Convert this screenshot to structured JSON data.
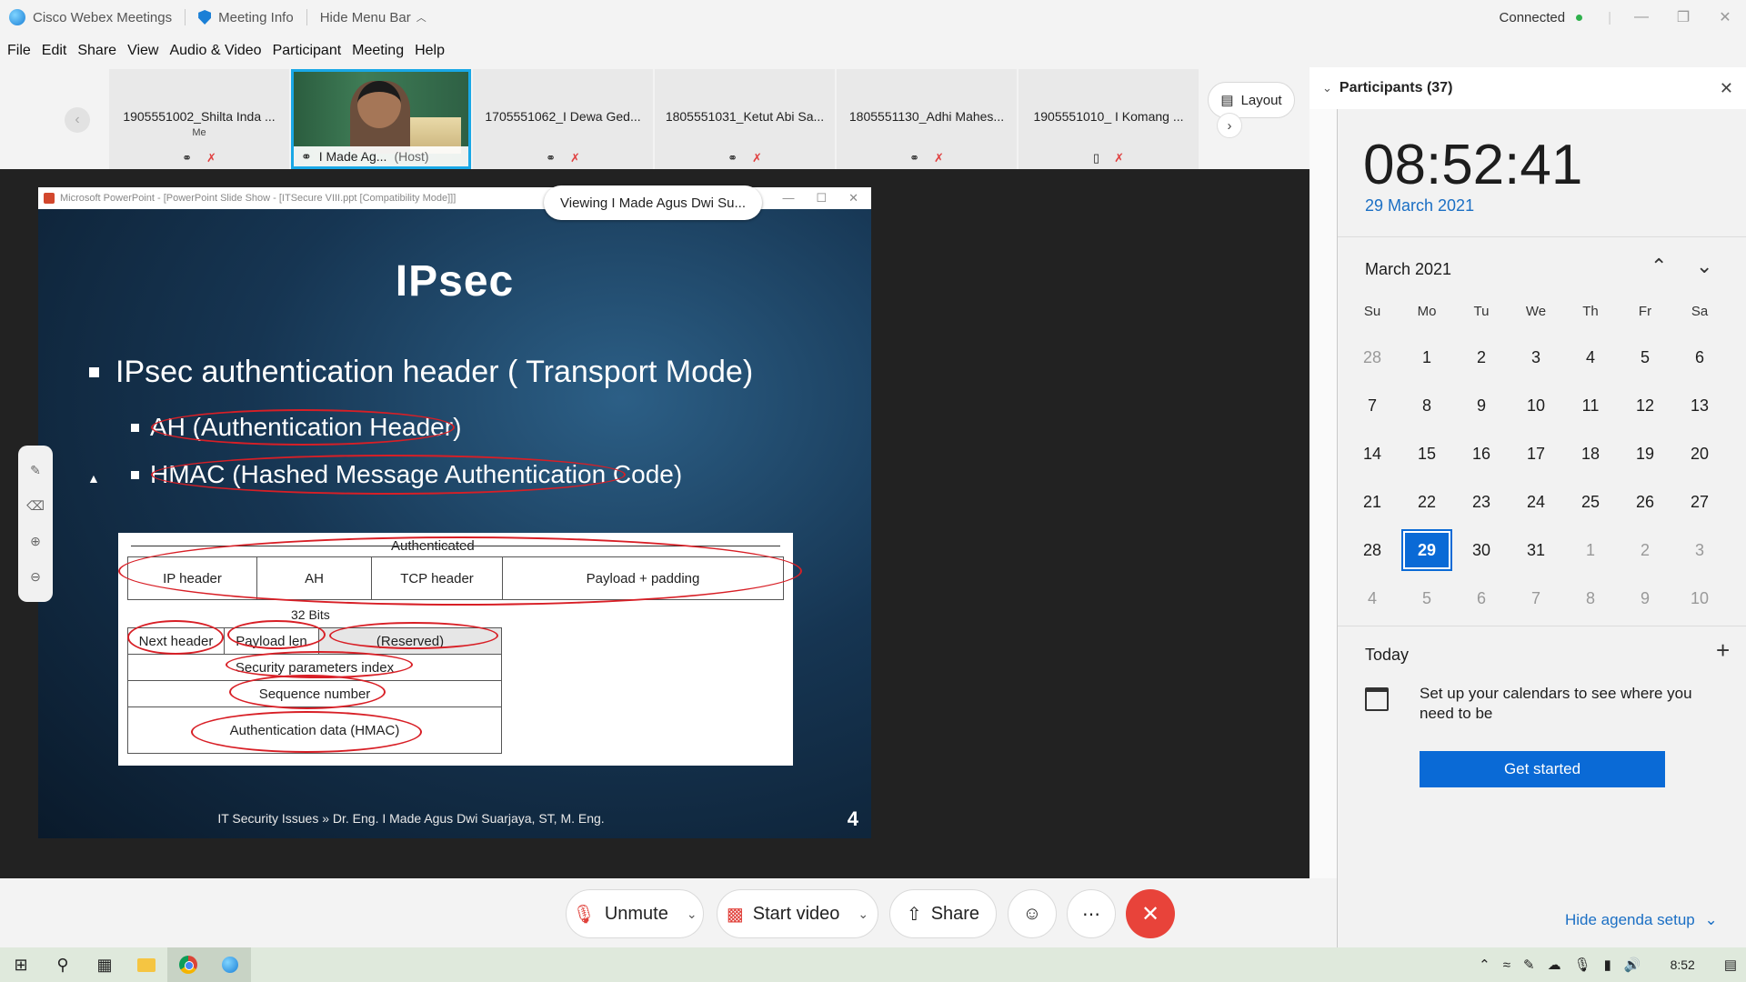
{
  "titlebar": {
    "app_name": "Cisco Webex Meetings",
    "meeting_info": "Meeting Info",
    "hide_menu_bar": "Hide Menu Bar",
    "status": "Connected"
  },
  "menu": [
    "File",
    "Edit",
    "Share",
    "View",
    "Audio & Video",
    "Participant",
    "Meeting",
    "Help"
  ],
  "thumbnails": [
    {
      "name": "1905551002_Shilta Inda ...",
      "sub": "Me"
    },
    {
      "name": "I Made Ag...",
      "sub": "(Host)"
    },
    {
      "name": "1705551062_I Dewa Ged..."
    },
    {
      "name": "1805551031_Ketut Abi Sa..."
    },
    {
      "name": "1805551130_Adhi Mahes..."
    },
    {
      "name": "1905551010_ I Komang ..."
    }
  ],
  "layout_button": "Layout",
  "slide": {
    "window_title": "Microsoft PowerPoint - [PowerPoint Slide Show - [ITSecure VIII.ppt [Compatibility Mode]]]",
    "viewing": "Viewing I Made Agus Dwi Su...",
    "heading": "IPsec",
    "bullet_main": "IPsec authentication header ( Transport Mode)",
    "bullet_sub1": "AH (Authentication Header)",
    "bullet_sub2": "HMAC (Hashed Message Authentication Code)",
    "diagram": {
      "authenticated": "Authenticated",
      "row1": [
        "IP header",
        "AH",
        "TCP header",
        "Payload + padding"
      ],
      "bits": "32 Bits",
      "next_header": "Next header",
      "payload_len": "Payload len",
      "reserved": "(Reserved)",
      "spi": "Security parameters index",
      "seq": "Sequence number",
      "auth_data": "Authentication data (HMAC)"
    },
    "footer": "IT Security Issues » Dr. Eng. I Made Agus Dwi Suarjaya, ST, M. Eng.",
    "page_number": "4"
  },
  "controls": {
    "unmute": "Unmute",
    "start_video": "Start video",
    "share": "Share"
  },
  "participants": {
    "title": "Participants (37)"
  },
  "calendar": {
    "time": "08:52:41",
    "date": "29 March 2021",
    "month": "March 2021",
    "dow": [
      "Su",
      "Mo",
      "Tu",
      "We",
      "Th",
      "Fr",
      "Sa"
    ],
    "weeks": [
      [
        "28",
        "1",
        "2",
        "3",
        "4",
        "5",
        "6"
      ],
      [
        "7",
        "8",
        "9",
        "10",
        "11",
        "12",
        "13"
      ],
      [
        "14",
        "15",
        "16",
        "17",
        "18",
        "19",
        "20"
      ],
      [
        "21",
        "22",
        "23",
        "24",
        "25",
        "26",
        "27"
      ],
      [
        "28",
        "29",
        "30",
        "31",
        "1",
        "2",
        "3"
      ],
      [
        "4",
        "5",
        "6",
        "7",
        "8",
        "9",
        "10"
      ]
    ],
    "selected_day": "29",
    "today_label": "Today",
    "setup_text": "Set up your calendars to see where you need to be",
    "get_started": "Get started",
    "hide_agenda": "Hide agenda setup"
  },
  "taskbar": {
    "clock": "8:52"
  }
}
